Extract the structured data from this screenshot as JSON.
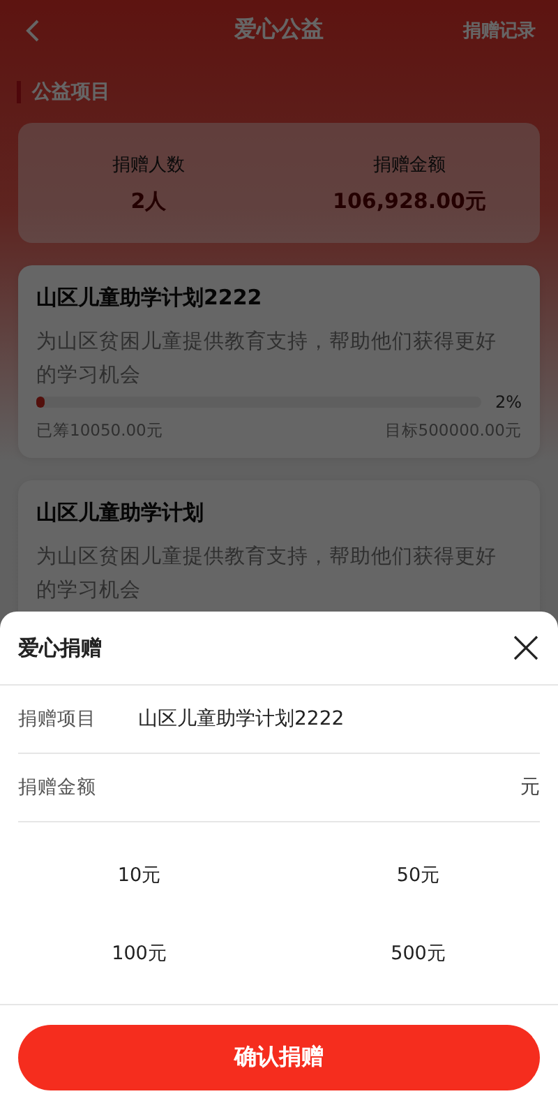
{
  "nav": {
    "title": "爱心公益",
    "action": "捐赠记录"
  },
  "section": {
    "title": "公益项目"
  },
  "stats": [
    {
      "label": "捐赠人数",
      "value": "2人"
    },
    {
      "label": "捐赠金额",
      "value": "106,928.00元"
    }
  ],
  "projects": [
    {
      "name": "山区儿童助学计划2222",
      "description": "为山区贫困儿童提供教育支持，帮助他们获得更好的学习机会",
      "level": 0.02,
      "percent": "2%",
      "raised": "已筹10050.00元",
      "target": "目标500000.00元"
    },
    {
      "name": "山区儿童助学计划",
      "description": "为山区贫困儿童提供教育支持，帮助他们获得更好的学习机会"
    }
  ],
  "sheet": {
    "title": "爱心捐赠",
    "project": {
      "label": "捐赠项目",
      "value": "山区儿童助学计划2222"
    },
    "amount": {
      "label": "捐赠金额",
      "unit": "元"
    },
    "options": [
      "10元",
      "50元",
      "100元",
      "500元"
    ],
    "confirm": "确认捐赠"
  }
}
